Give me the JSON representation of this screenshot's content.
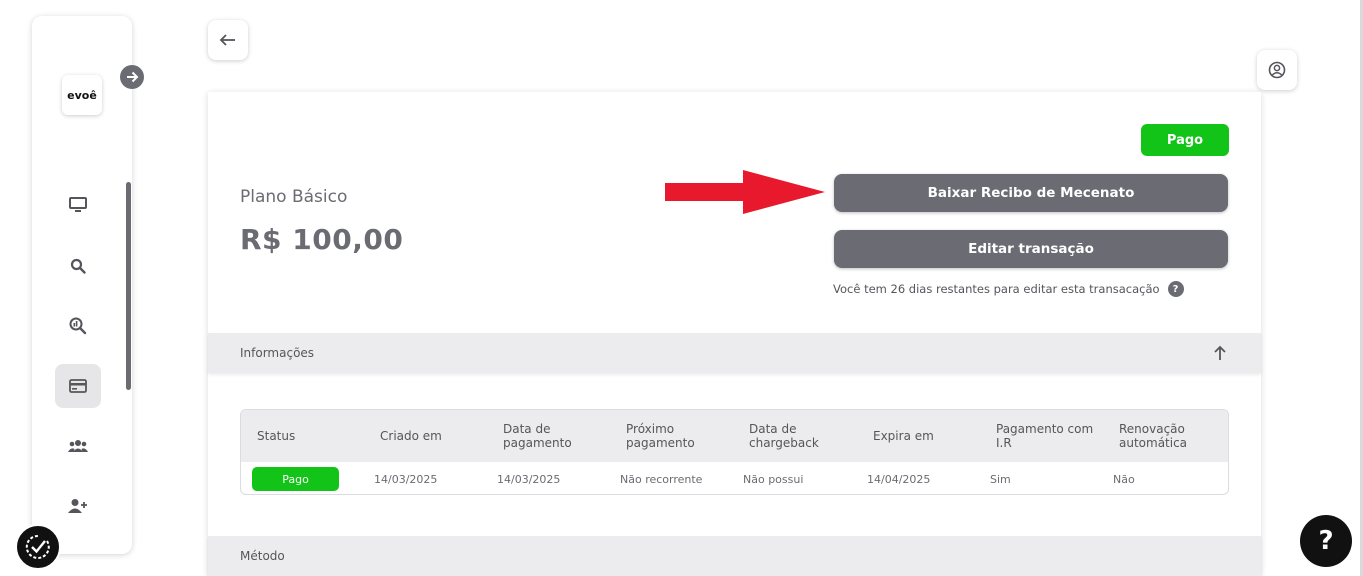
{
  "sidebar": {
    "logo_text": "evoê",
    "items": [
      {
        "icon": "monitor-icon"
      },
      {
        "icon": "search-icon"
      },
      {
        "icon": "analytics-search-icon"
      },
      {
        "icon": "credit-card-icon",
        "active": true
      },
      {
        "icon": "group-icon"
      },
      {
        "icon": "add-user-icon"
      }
    ]
  },
  "header": {
    "back_icon": "arrow-left-icon",
    "user_icon": "user-circle-icon"
  },
  "transaction": {
    "status": "Pago",
    "plan_name": "Plano Básico",
    "price": "R$ 100,00",
    "download_receipt_label": "Baixar Recibo de Mecenato",
    "edit_label": "Editar transação",
    "edit_note": "Você tem 26 dias restantes para editar esta transacação",
    "help_mark": "?"
  },
  "sections": {
    "info_title": "Informações",
    "method_title": "Método"
  },
  "table": {
    "headers": [
      "Status",
      "Criado em",
      "Data de pagamento",
      "Próximo pagamento",
      "Data de chargeback",
      "Expira em",
      "Pagamento com I.R",
      "Renovação automática"
    ],
    "row": {
      "status": "Pago",
      "created": "14/03/2025",
      "paid": "14/03/2025",
      "next": "Não recorrente",
      "chargeback": "Não possui",
      "expires": "14/04/2025",
      "ir": "Sim",
      "auto_renew": "Não"
    }
  },
  "floating_help": "?",
  "colors": {
    "accent_green": "#12c318",
    "button_gray": "#6b6b73",
    "annotation_red": "#e8192c"
  }
}
